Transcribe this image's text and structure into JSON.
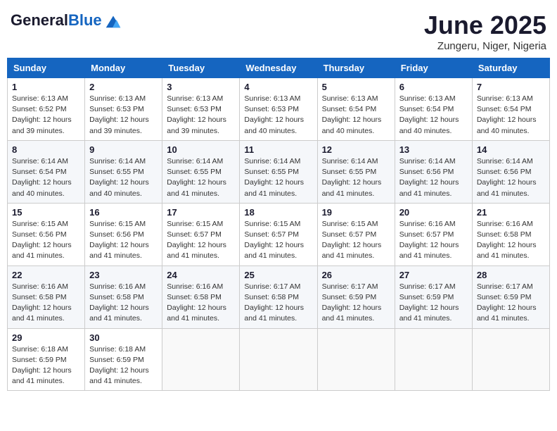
{
  "header": {
    "logo_general": "General",
    "logo_blue": "Blue",
    "month_title": "June 2025",
    "location": "Zungeru, Niger, Nigeria"
  },
  "days_of_week": [
    "Sunday",
    "Monday",
    "Tuesday",
    "Wednesday",
    "Thursday",
    "Friday",
    "Saturday"
  ],
  "weeks": [
    [
      {
        "day": "1",
        "sunrise": "6:13 AM",
        "sunset": "6:52 PM",
        "daylight": "12 hours and 39 minutes."
      },
      {
        "day": "2",
        "sunrise": "6:13 AM",
        "sunset": "6:53 PM",
        "daylight": "12 hours and 39 minutes."
      },
      {
        "day": "3",
        "sunrise": "6:13 AM",
        "sunset": "6:53 PM",
        "daylight": "12 hours and 39 minutes."
      },
      {
        "day": "4",
        "sunrise": "6:13 AM",
        "sunset": "6:53 PM",
        "daylight": "12 hours and 40 minutes."
      },
      {
        "day": "5",
        "sunrise": "6:13 AM",
        "sunset": "6:54 PM",
        "daylight": "12 hours and 40 minutes."
      },
      {
        "day": "6",
        "sunrise": "6:13 AM",
        "sunset": "6:54 PM",
        "daylight": "12 hours and 40 minutes."
      },
      {
        "day": "7",
        "sunrise": "6:13 AM",
        "sunset": "6:54 PM",
        "daylight": "12 hours and 40 minutes."
      }
    ],
    [
      {
        "day": "8",
        "sunrise": "6:14 AM",
        "sunset": "6:54 PM",
        "daylight": "12 hours and 40 minutes."
      },
      {
        "day": "9",
        "sunrise": "6:14 AM",
        "sunset": "6:55 PM",
        "daylight": "12 hours and 40 minutes."
      },
      {
        "day": "10",
        "sunrise": "6:14 AM",
        "sunset": "6:55 PM",
        "daylight": "12 hours and 41 minutes."
      },
      {
        "day": "11",
        "sunrise": "6:14 AM",
        "sunset": "6:55 PM",
        "daylight": "12 hours and 41 minutes."
      },
      {
        "day": "12",
        "sunrise": "6:14 AM",
        "sunset": "6:55 PM",
        "daylight": "12 hours and 41 minutes."
      },
      {
        "day": "13",
        "sunrise": "6:14 AM",
        "sunset": "6:56 PM",
        "daylight": "12 hours and 41 minutes."
      },
      {
        "day": "14",
        "sunrise": "6:14 AM",
        "sunset": "6:56 PM",
        "daylight": "12 hours and 41 minutes."
      }
    ],
    [
      {
        "day": "15",
        "sunrise": "6:15 AM",
        "sunset": "6:56 PM",
        "daylight": "12 hours and 41 minutes."
      },
      {
        "day": "16",
        "sunrise": "6:15 AM",
        "sunset": "6:56 PM",
        "daylight": "12 hours and 41 minutes."
      },
      {
        "day": "17",
        "sunrise": "6:15 AM",
        "sunset": "6:57 PM",
        "daylight": "12 hours and 41 minutes."
      },
      {
        "day": "18",
        "sunrise": "6:15 AM",
        "sunset": "6:57 PM",
        "daylight": "12 hours and 41 minutes."
      },
      {
        "day": "19",
        "sunrise": "6:15 AM",
        "sunset": "6:57 PM",
        "daylight": "12 hours and 41 minutes."
      },
      {
        "day": "20",
        "sunrise": "6:16 AM",
        "sunset": "6:57 PM",
        "daylight": "12 hours and 41 minutes."
      },
      {
        "day": "21",
        "sunrise": "6:16 AM",
        "sunset": "6:58 PM",
        "daylight": "12 hours and 41 minutes."
      }
    ],
    [
      {
        "day": "22",
        "sunrise": "6:16 AM",
        "sunset": "6:58 PM",
        "daylight": "12 hours and 41 minutes."
      },
      {
        "day": "23",
        "sunrise": "6:16 AM",
        "sunset": "6:58 PM",
        "daylight": "12 hours and 41 minutes."
      },
      {
        "day": "24",
        "sunrise": "6:16 AM",
        "sunset": "6:58 PM",
        "daylight": "12 hours and 41 minutes."
      },
      {
        "day": "25",
        "sunrise": "6:17 AM",
        "sunset": "6:58 PM",
        "daylight": "12 hours and 41 minutes."
      },
      {
        "day": "26",
        "sunrise": "6:17 AM",
        "sunset": "6:59 PM",
        "daylight": "12 hours and 41 minutes."
      },
      {
        "day": "27",
        "sunrise": "6:17 AM",
        "sunset": "6:59 PM",
        "daylight": "12 hours and 41 minutes."
      },
      {
        "day": "28",
        "sunrise": "6:17 AM",
        "sunset": "6:59 PM",
        "daylight": "12 hours and 41 minutes."
      }
    ],
    [
      {
        "day": "29",
        "sunrise": "6:18 AM",
        "sunset": "6:59 PM",
        "daylight": "12 hours and 41 minutes."
      },
      {
        "day": "30",
        "sunrise": "6:18 AM",
        "sunset": "6:59 PM",
        "daylight": "12 hours and 41 minutes."
      },
      null,
      null,
      null,
      null,
      null
    ]
  ],
  "labels": {
    "sunrise": "Sunrise:",
    "sunset": "Sunset:",
    "daylight": "Daylight:"
  }
}
